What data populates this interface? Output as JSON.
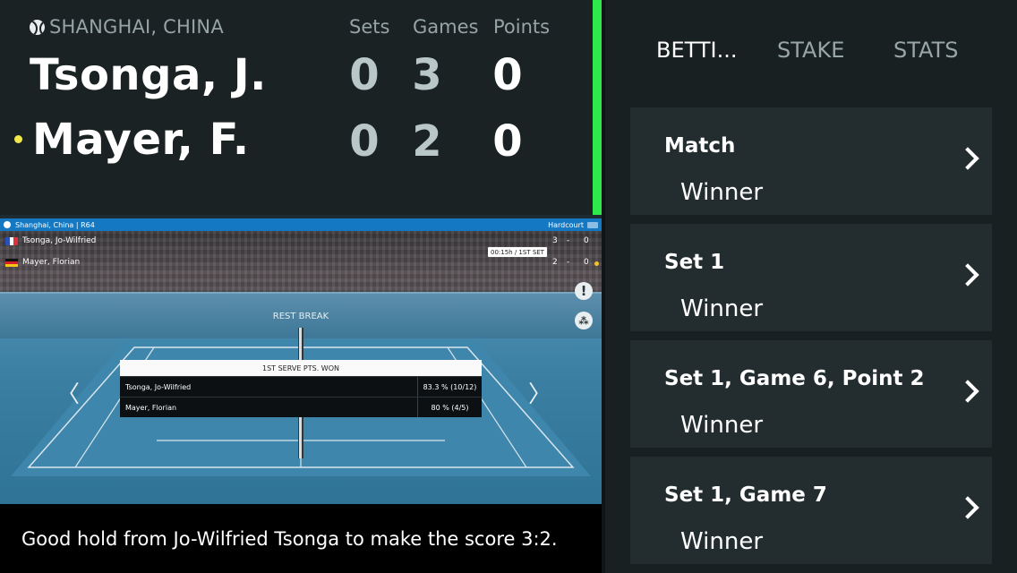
{
  "scoreboard": {
    "venue": "SHANGHAI, CHINA",
    "headers": {
      "sets": "Sets",
      "games": "Games",
      "points": "Points"
    },
    "players": [
      {
        "name": "Tsonga, J.",
        "sets": "0",
        "games": "3",
        "points": "0",
        "serving": false
      },
      {
        "name": "Mayer, F.",
        "sets": "0",
        "games": "2",
        "points": "0",
        "serving": true
      }
    ],
    "accent_color": "#2fe84a"
  },
  "video": {
    "location": "Shanghai, China | R64",
    "surface": "Hardcourt",
    "players": [
      {
        "name": "Tsonga, Jo-Wilfried",
        "games": "3",
        "sep": "-",
        "points": "0"
      },
      {
        "name": "Mayer, Florian",
        "games": "2",
        "sep": "-",
        "points": "0"
      }
    ],
    "timer": "00:15h  /  1ST SET",
    "status": "REST BREAK",
    "stat_panel": {
      "title": "1ST SERVE PTS. WON",
      "rows": [
        {
          "name": "Tsonga, Jo-Wilfried",
          "value": "83.3 % (10/12)"
        },
        {
          "name": "Mayer, Florian",
          "value": "80 % (4/5)"
        }
      ]
    },
    "icons": [
      "alert-icon",
      "share-icon",
      "prev-arrow-icon",
      "next-arrow-icon"
    ],
    "nav": {
      "prev": "〈",
      "next": "〉"
    }
  },
  "commentary": "Good hold from Jo-Wilfried Tsonga to make the score 3:2.",
  "tabs": [
    {
      "label": "BETTI...",
      "active": true
    },
    {
      "label": "STAKE",
      "active": false
    },
    {
      "label": "STATS",
      "active": false
    }
  ],
  "markets": [
    {
      "title": "Match",
      "subtitle": "Winner"
    },
    {
      "title": "Set 1",
      "subtitle": "Winner"
    },
    {
      "title": "Set 1, Game 6, Point 2",
      "subtitle": "Winner"
    },
    {
      "title": "Set 1, Game 7",
      "subtitle": "Winner"
    }
  ]
}
